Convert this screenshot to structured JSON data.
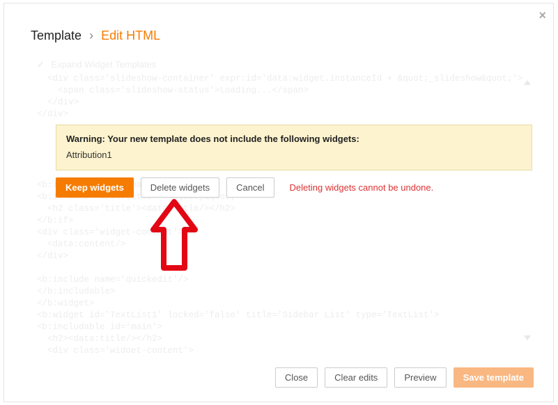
{
  "close_glyph": "×",
  "breadcrumb": {
    "root": "Template",
    "sep": "›",
    "leaf": "Edit HTML"
  },
  "expand_label": "Expand Widget Templates",
  "code_lines": [
    "  <div class='slideshow-container' expr:id='data:widget.instanceId + &quot;_slideshow&quot;'>",
    "    <span class='slideshow-status'>Loading...</span>",
    "  </div>",
    "</div>",
    "",
    "",
    "",
    "",
    "",
    "<b:includable id='main'>",
    "<b:if cond='data:title != &quot;&quot;'>",
    "  <h2 class='title'><data:title/></h2>",
    "</b:if>",
    "<div class='widget-content'>",
    "  <data:content/>",
    "</div>",
    "",
    "<b:include name='quickedit'/>",
    "</b:includable>",
    "</b:widget>",
    "<b:widget id='TextList1' locked='false' title='Sidebar List' type='TextList'>",
    "<b:includable id='main'>",
    "  <h2><data:title/></h2>",
    "  <div class='widget-content'>"
  ],
  "warning": {
    "title": "Warning: Your new template does not include the following widgets:",
    "items": [
      "Attribution1"
    ]
  },
  "actions": {
    "keep": "Keep widgets",
    "delete": "Delete widgets",
    "cancel": "Cancel",
    "msg": "Deleting widgets cannot be undone."
  },
  "footer": {
    "close": "Close",
    "clear": "Clear edits",
    "preview": "Preview",
    "save": "Save template"
  }
}
